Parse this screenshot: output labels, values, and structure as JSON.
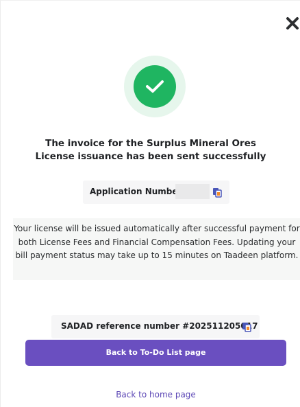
{
  "colors": {
    "primary": "#6a4fc0",
    "success": "#1fb561",
    "success_ring": "#e6f6ec",
    "copy_icon": "#4a57b8"
  },
  "icons": {
    "close": "close-icon",
    "success": "checkmark-icon",
    "copy": "copy-icon"
  },
  "modal": {
    "title": "The invoice for the Surplus Mineral Ores License issuance has been sent successfully",
    "application": {
      "label": "Application Number",
      "value": ""
    },
    "info_message": "Your license will be issued automatically after successful payment for both License Fees and Financial Compensation Fees. Updating your bill payment status may take up to 15 minutes on Taadeen platform.",
    "sadad": {
      "label": "SADAD reference number #202511205017"
    },
    "buttons": {
      "primary": "Back to To-Do List page",
      "secondary": "Back to home page"
    }
  }
}
